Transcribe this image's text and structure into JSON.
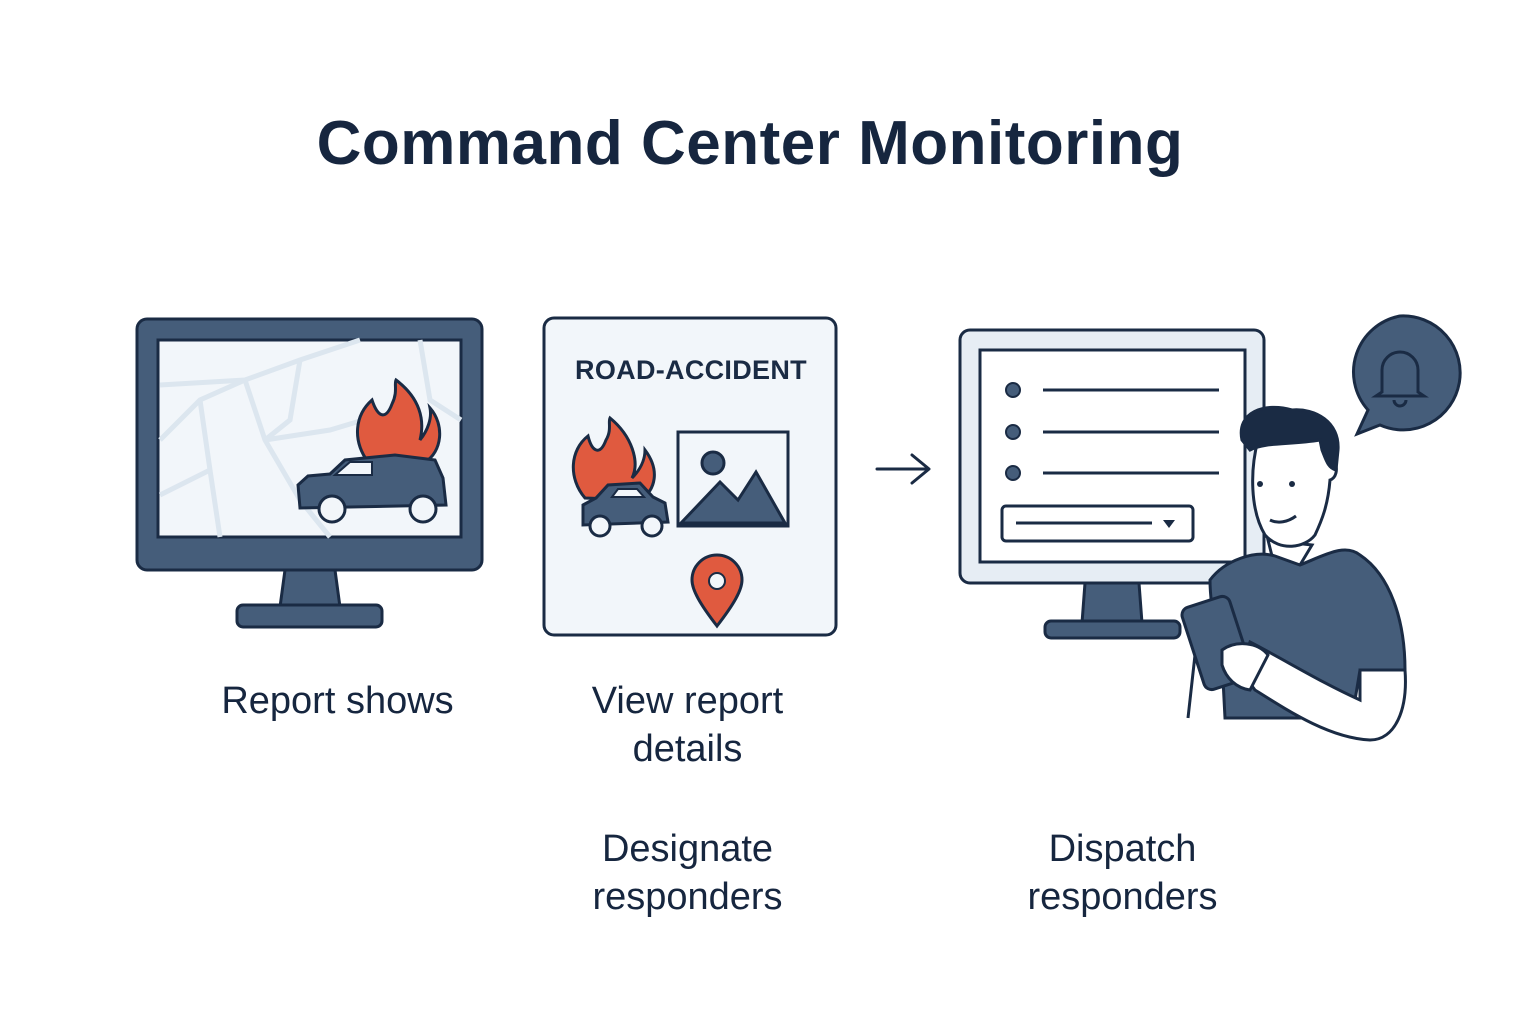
{
  "title": "Command Center Monitoring",
  "card_label": "ROAD-ACCIDENT",
  "captions": {
    "report_shows": "Report shows",
    "view_details": "View report\ndetails",
    "designate": "Designate\nresponders",
    "dispatch": "Dispatch\nresponders"
  },
  "colors": {
    "navy": "#455d7a",
    "outline": "#1a2b44",
    "fire": "#e05a3f",
    "screen_bg": "#f2f6fa",
    "map_lines": "#dce6ef"
  },
  "icons": [
    "monitor-icon",
    "map-icon",
    "burning-car-icon",
    "image-icon",
    "location-pin-icon",
    "arrow-right-icon",
    "bell-icon",
    "person-icon",
    "tablet-icon"
  ]
}
